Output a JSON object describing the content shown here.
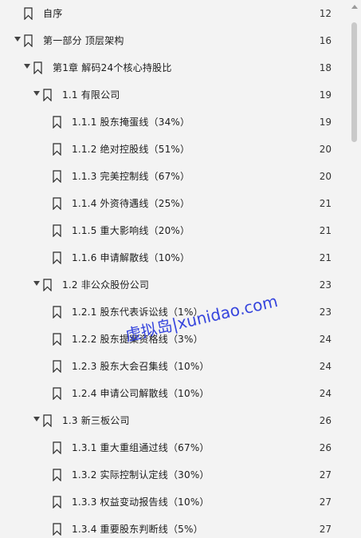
{
  "toc": [
    {
      "level": 0,
      "expanded": null,
      "title": "自序",
      "page": "12"
    },
    {
      "level": 0,
      "expanded": true,
      "title": "第一部分 顶层架构",
      "page": "16"
    },
    {
      "level": 1,
      "expanded": true,
      "title": "第1章 解码24个核心持股比",
      "page": "18"
    },
    {
      "level": 2,
      "expanded": true,
      "title": "1.1 有限公司",
      "page": "19"
    },
    {
      "level": 3,
      "expanded": null,
      "title": "1.1.1 股东掩蛋线（34%）",
      "page": "19"
    },
    {
      "level": 3,
      "expanded": null,
      "title": "1.1.2 绝对控股线（51%）",
      "page": "20"
    },
    {
      "level": 3,
      "expanded": null,
      "title": "1.1.3 完美控制线（67%）",
      "page": "20"
    },
    {
      "level": 3,
      "expanded": null,
      "title": "1.1.4 外资待遇线（25%）",
      "page": "21"
    },
    {
      "level": 3,
      "expanded": null,
      "title": "1.1.5 重大影响线（20%）",
      "page": "21"
    },
    {
      "level": 3,
      "expanded": null,
      "title": "1.1.6 申请解散线（10%）",
      "page": "21"
    },
    {
      "level": 2,
      "expanded": true,
      "title": "1.2 非公众股份公司",
      "page": "23"
    },
    {
      "level": 3,
      "expanded": null,
      "title": "1.2.1 股东代表诉讼线（1%）",
      "page": "23"
    },
    {
      "level": 3,
      "expanded": null,
      "title": "1.2.2 股东提案资格线（3%）",
      "page": "24"
    },
    {
      "level": 3,
      "expanded": null,
      "title": "1.2.3 股东大会召集线（10%）",
      "page": "24"
    },
    {
      "level": 3,
      "expanded": null,
      "title": "1.2.4 申请公司解散线（10%）",
      "page": "24"
    },
    {
      "level": 2,
      "expanded": true,
      "title": "1.3 新三板公司",
      "page": "26"
    },
    {
      "level": 3,
      "expanded": null,
      "title": "1.3.1 重大重组通过线（67%）",
      "page": "26"
    },
    {
      "level": 3,
      "expanded": null,
      "title": "1.3.2 实际控制认定线（30%）",
      "page": "27"
    },
    {
      "level": 3,
      "expanded": null,
      "title": "1.3.3 权益变动报告线（10%）",
      "page": "27"
    },
    {
      "level": 3,
      "expanded": null,
      "title": "1.3.4 重要股东判断线（5%）",
      "page": "27"
    }
  ],
  "watermark": "虚拟岛|xunidao.com",
  "colors": {
    "background": "#f3f3f3",
    "text": "#1b1b1b",
    "watermark": "#2b3bdc",
    "scrollbar_thumb": "#c9c9c9"
  },
  "icons": {
    "bookmark": "bookmark-icon",
    "expand": "chevron-down-icon"
  }
}
